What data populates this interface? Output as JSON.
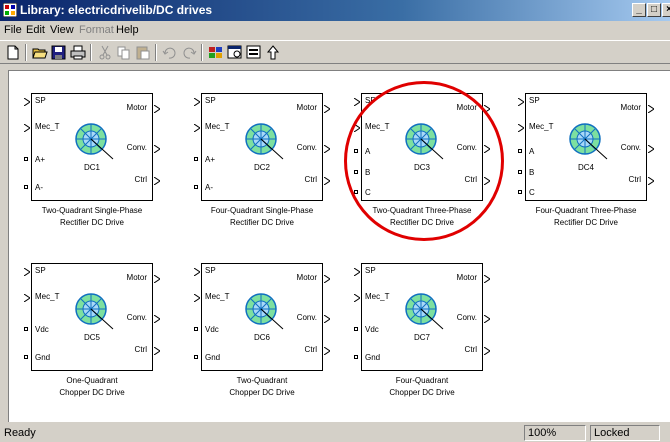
{
  "window": {
    "title": "Library: electricdrivelib/DC drives",
    "controls": [
      "_",
      "□",
      "×"
    ]
  },
  "menu": {
    "items": [
      {
        "label": "File",
        "enabled": true
      },
      {
        "label": "Edit",
        "enabled": true
      },
      {
        "label": "View",
        "enabled": true
      },
      {
        "label": "Format",
        "enabled": false
      },
      {
        "label": "Help",
        "enabled": true
      }
    ]
  },
  "toolbar": {
    "buttons": [
      "new-icon",
      "open-icon",
      "save-icon",
      "print-icon",
      "cut-icon",
      "copy-icon",
      "paste-icon",
      "undo-icon",
      "redo-icon",
      "library-browser-icon",
      "model-explorer-icon",
      "debugger-icon",
      "go-to-parent-icon"
    ]
  },
  "blocks": [
    {
      "name": "DC1",
      "caption": [
        "Two-Quadrant Single-Phase",
        "Rectifier DC Drive"
      ],
      "inputs": [
        "SP",
        "Mec_T"
      ],
      "power": [
        "A+",
        "A-"
      ],
      "outputs": [
        "Motor",
        "Conv.",
        "Ctrl"
      ]
    },
    {
      "name": "DC2",
      "caption": [
        "Four-Quadrant Single-Phase",
        "Rectifier DC Drive"
      ],
      "inputs": [
        "SP",
        "Mec_T"
      ],
      "power": [
        "A+",
        "A-"
      ],
      "outputs": [
        "Motor",
        "Conv.",
        "Ctrl"
      ]
    },
    {
      "name": "DC3",
      "caption": [
        "Two-Quadrant Three-Phase",
        "Rectifier DC Drive"
      ],
      "inputs": [
        "SP",
        "Mec_T"
      ],
      "power": [
        "A",
        "B",
        "C"
      ],
      "outputs": [
        "Motor",
        "Conv.",
        "Ctrl"
      ]
    },
    {
      "name": "DC4",
      "caption": [
        "Four-Quadrant Three-Phase",
        "Rectifier DC Drive"
      ],
      "inputs": [
        "SP",
        "Mec_T"
      ],
      "power": [
        "A",
        "B",
        "C"
      ],
      "outputs": [
        "Motor",
        "Conv.",
        "Ctrl"
      ]
    },
    {
      "name": "DC5",
      "caption": [
        "One-Quadrant",
        "Chopper DC Drive"
      ],
      "inputs": [
        "SP",
        "Mec_T"
      ],
      "power": [
        "Vdc",
        "Gnd"
      ],
      "outputs": [
        "Motor",
        "Conv.",
        "Ctrl"
      ]
    },
    {
      "name": "DC6",
      "caption": [
        "Two-Quadrant",
        "Chopper DC Drive"
      ],
      "inputs": [
        "SP",
        "Mec_T"
      ],
      "power": [
        "Vdc",
        "Gnd"
      ],
      "outputs": [
        "Motor",
        "Conv.",
        "Ctrl"
      ]
    },
    {
      "name": "DC7",
      "caption": [
        "Four-Quadrant",
        "Chopper DC Drive"
      ],
      "inputs": [
        "SP",
        "Mec_T"
      ],
      "power": [
        "Vdc",
        "Gnd"
      ],
      "outputs": [
        "Motor",
        "Conv.",
        "Ctrl"
      ]
    }
  ],
  "status": {
    "text": "Ready",
    "zoom": "100%",
    "lock": "Locked"
  },
  "colors": {
    "title_start": "#0a246a",
    "title_end": "#a6caf0",
    "highlight": "#e00000",
    "icon_fill": "#7de0a0",
    "icon_stroke": "#1070c0"
  }
}
